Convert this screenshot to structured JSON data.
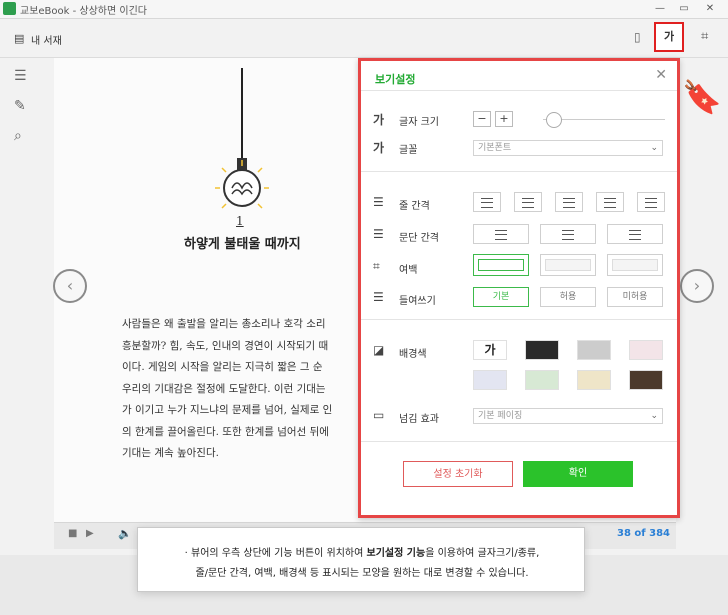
{
  "window": {
    "title": "교보eBook - 상상하면 이긴다",
    "min": "—",
    "max": "▭",
    "close": "✕"
  },
  "toolbar": {
    "library_icon": "book-icon",
    "library_label": "내 서재",
    "font_button_label": "가"
  },
  "leftbar": {
    "icons": [
      "list-icon",
      "edit-icon",
      "search-icon"
    ]
  },
  "book": {
    "chapter_number": "1",
    "chapter_title": "하얗게 불태울 때까지",
    "lines": [
      "사람들은 왜 출발을 알리는 총소리나 호각 소리",
      "흥분할까? 힘, 속도, 인내의 경연이 시작되기 때",
      "이다. 게임의 시작을 알리는 지극히 짧은 그 순",
      "우리의 기대감은 절정에 도달한다. 이런 기대는",
      "가 이기고 누가 지느냐의 문제를 넘어, 실제로 인",
      "의 한계를 끌어올린다. 또한 한계를 넘어선 뒤에",
      "기대는 계속 높아진다."
    ],
    "page_indicator": "38 of 384"
  },
  "dialog": {
    "title": "보기설정",
    "font_size_label": "글자 크기",
    "font_size_minus": "−",
    "font_size_plus": "+",
    "font_size_level": 0.03,
    "font_label": "글꼴",
    "font_value": "기본폰트",
    "line_spacing_label": "줄 간격",
    "paragraph_spacing_label": "문단 간격",
    "margin_label": "여백",
    "indent_label": "들여쓰기",
    "indent_options": [
      "기본",
      "허용",
      "미허용"
    ],
    "bg_label": "배경색",
    "bg_sample": "가",
    "bg_colors": [
      "#ffffff",
      "#2a2a2a",
      "#cccccc",
      "#f3e4e8",
      "#e3e5f1",
      "#d7e9d4",
      "#efe5c8",
      "#4c3a2c"
    ],
    "page_effect_label": "넘김 효과",
    "page_effect_value": "기본 페이징",
    "reset_label": "설정 초기화",
    "ok_label": "확인"
  },
  "caption": {
    "line1_a": "· 뷰어의 우측 상단에 기능 버튼이 위치하여 ",
    "line1_bold": "보기설정 기능",
    "line1_b": "을 이용하여 글자크기/종류,",
    "line2": "줄/문단 간격, 여백, 배경색 등 표시되는 모양을 원하는 대로 변경할 수 있습니다."
  }
}
